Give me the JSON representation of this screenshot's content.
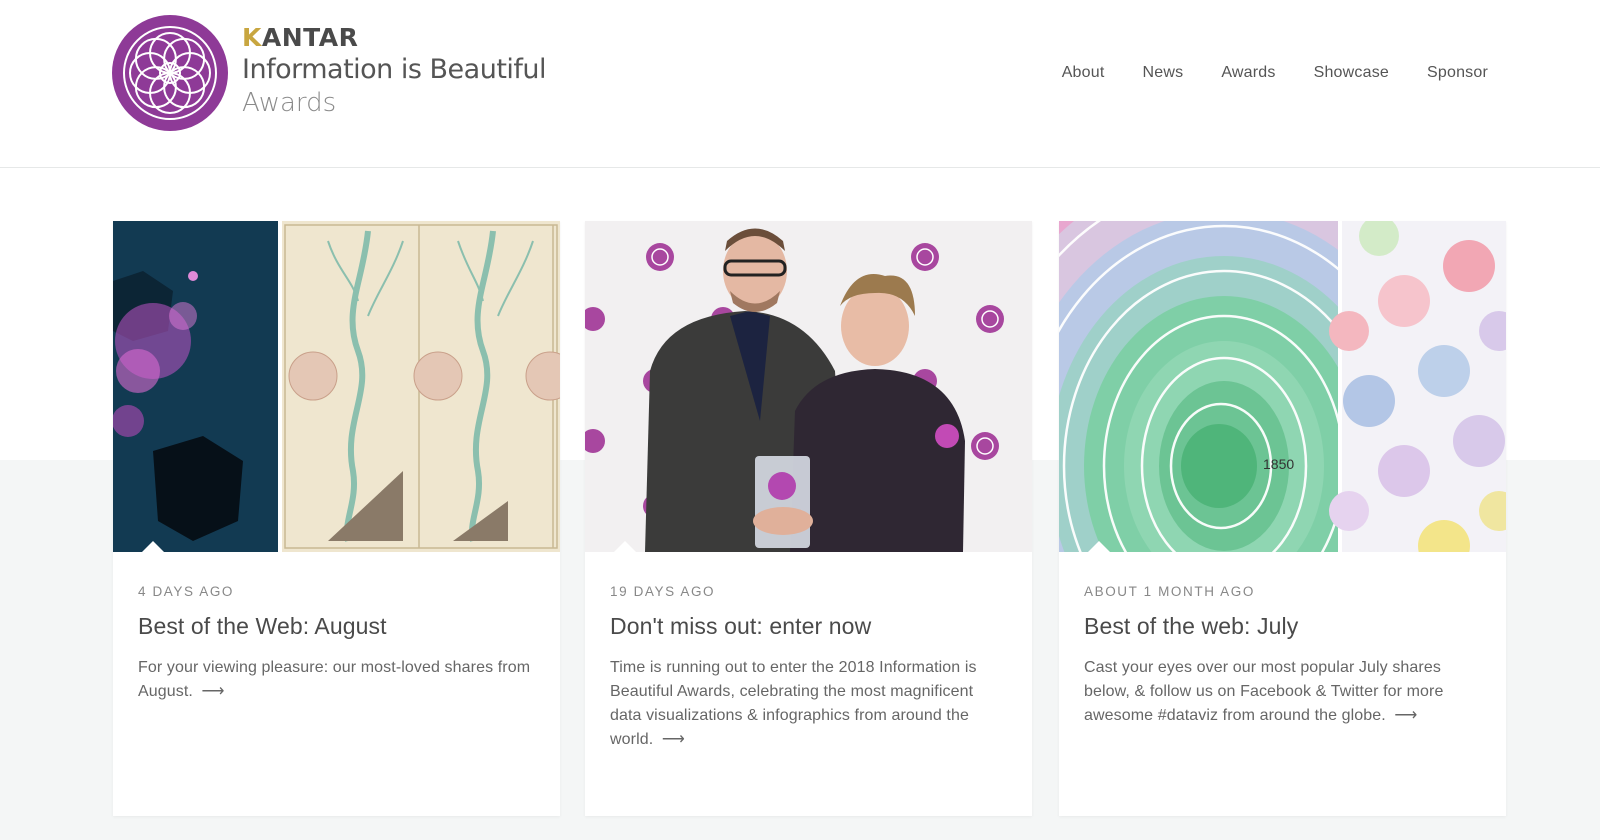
{
  "header": {
    "brand": {
      "kantar_first": "K",
      "kantar_rest": "ANTAR",
      "line2": "Information is Beautiful",
      "line3": "Awards"
    },
    "nav": [
      {
        "label": "About"
      },
      {
        "label": "News"
      },
      {
        "label": "Awards"
      },
      {
        "label": "Showcase"
      },
      {
        "label": "Sponsor"
      }
    ]
  },
  "colors": {
    "accent_purple": "#8e3a97",
    "band_gray": "#f4f6f6",
    "brand_gold": "#c8a640"
  },
  "cards": [
    {
      "date": "4 days ago",
      "title": "Best of the Web: August",
      "excerpt": "For your viewing pleasure: our most-loved shares from August.",
      "arrow": "⟶",
      "image": "world-map-and-river-chart"
    },
    {
      "date": "19 days ago",
      "title": "Don't miss out: enter now",
      "excerpt": "Time is running out to enter the 2018 Information is Beautiful Awards, celebrating the most magnificent data visualizations & infographics from around the world.",
      "arrow": "⟶",
      "image": "two-men-holding-award-photo"
    },
    {
      "date": "about 1 month ago",
      "title": "Best of the web: July",
      "excerpt": "Cast your eyes over our most popular July shares below, & follow us on Facebook & Twitter for more awesome #dataviz from around the globe.",
      "arrow": "⟶",
      "image": "tree-rings-and-chart-types",
      "image_label": "1850"
    }
  ]
}
